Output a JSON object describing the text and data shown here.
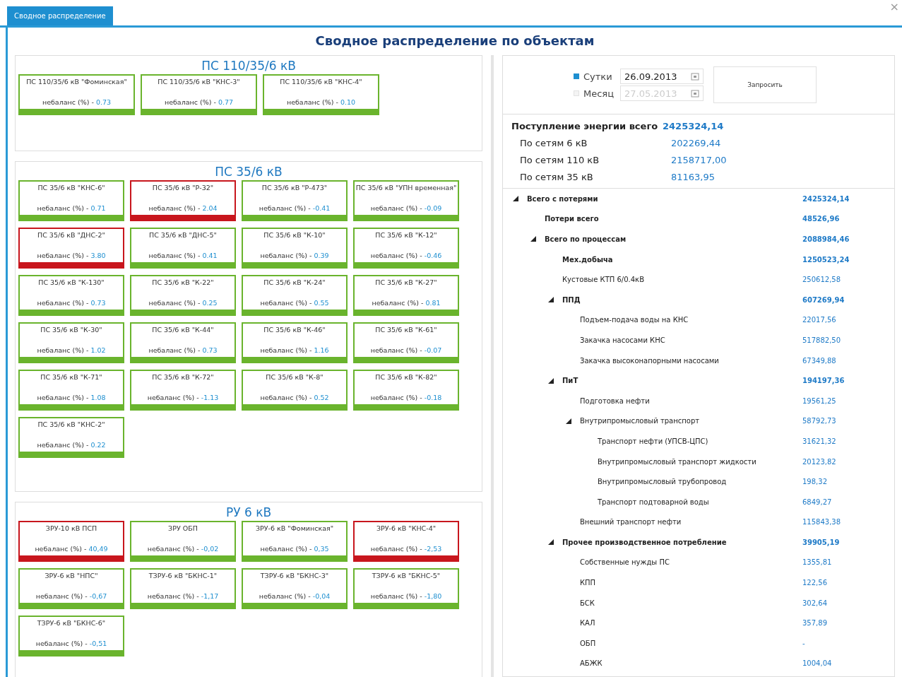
{
  "window": {
    "tab": "Сводное распределение",
    "close": "×"
  },
  "heading": "Сводное распределение по объектам",
  "groups": [
    {
      "title": "ПС 110/35/6 кВ",
      "wide": true,
      "cards": [
        {
          "name": "ПС 110/35/6 кВ \"Фоминская\"",
          "label": "небаланс (%) - ",
          "value": "0.73",
          "alarm": false
        },
        {
          "name": "ПС 110/35/6 кВ \"КНС-3\"",
          "label": "небаланс (%) - ",
          "value": "0.77",
          "alarm": false
        },
        {
          "name": "ПС 110/35/6 кВ \"КНС-4\"",
          "label": "небаланс (%) - ",
          "value": "0.10",
          "alarm": false
        }
      ]
    },
    {
      "title": "ПС 35/6 кВ",
      "wide": false,
      "cards": [
        {
          "name": "ПС 35/6 кВ \"КНС-6\"",
          "label": "небаланс (%) - ",
          "value": "0.71",
          "alarm": false
        },
        {
          "name": "ПС 35/6 кВ \"Р-32\"",
          "label": "небаланс (%) - ",
          "value": "2.04",
          "alarm": true
        },
        {
          "name": "ПС 35/6 кВ \"Р-473\"",
          "label": "небаланс (%) - ",
          "value": "-0.41",
          "alarm": false
        },
        {
          "name": "ПС 35/6 кВ \"УПН временная\"",
          "label": "небаланс (%) - ",
          "value": "-0.09",
          "alarm": false
        },
        {
          "name": "ПС 35/6 кВ \"ДНС-2\"",
          "label": "небаланс (%) - ",
          "value": "3.80",
          "alarm": true
        },
        {
          "name": "ПС 35/6 кВ \"ДНС-5\"",
          "label": "небаланс (%) - ",
          "value": "0.41",
          "alarm": false
        },
        {
          "name": "ПС 35/6 кВ \"К-10\"",
          "label": "небаланс (%) - ",
          "value": "0.39",
          "alarm": false
        },
        {
          "name": "ПС 35/6 кВ \"К-12\"",
          "label": "небаланс (%) - ",
          "value": "-0.46",
          "alarm": false
        },
        {
          "name": "ПС 35/6 кВ \"К-130\"",
          "label": "небаланс (%) - ",
          "value": "0.73",
          "alarm": false
        },
        {
          "name": "ПС 35/6 кВ \"К-22\"",
          "label": "небаланс (%) - ",
          "value": "0.25",
          "alarm": false
        },
        {
          "name": "ПС 35/6 кВ \"К-24\"",
          "label": "небаланс (%) - ",
          "value": "0.55",
          "alarm": false
        },
        {
          "name": "ПС 35/6 кВ \"К-27\"",
          "label": "небаланс (%) - ",
          "value": "0.81",
          "alarm": false
        },
        {
          "name": "ПС 35/6 кВ \"К-30\"",
          "label": "небаланс (%) - ",
          "value": "1.02",
          "alarm": false
        },
        {
          "name": "ПС 35/6 кВ \"К-44\"",
          "label": "небаланс (%) - ",
          "value": "0.73",
          "alarm": false
        },
        {
          "name": "ПС 35/6 кВ \"К-46\"",
          "label": "небаланс (%) - ",
          "value": "1.16",
          "alarm": false
        },
        {
          "name": "ПС 35/6 кВ \"К-61\"",
          "label": "небаланс (%) - ",
          "value": "-0.07",
          "alarm": false
        },
        {
          "name": "ПС 35/6 кВ \"К-71\"",
          "label": "небаланс (%) - ",
          "value": "1.08",
          "alarm": false
        },
        {
          "name": "ПС 35/6 кВ \"К-72\"",
          "label": "небаланс (%) - ",
          "value": "-1.13",
          "alarm": false
        },
        {
          "name": "ПС 35/6 кВ \"К-8\"",
          "label": "небаланс (%) - ",
          "value": "0.52",
          "alarm": false
        },
        {
          "name": "ПС 35/6 кВ \"К-82\"",
          "label": "небаланс (%) - ",
          "value": "-0.18",
          "alarm": false
        },
        {
          "name": "ПС 35/6 кВ \"КНС-2\"",
          "label": "небаланс (%) - ",
          "value": "0.22",
          "alarm": false
        }
      ]
    },
    {
      "title": "РУ 6 кВ",
      "wide": false,
      "cards": [
        {
          "name": "ЗРУ-10 кВ ПСП",
          "label": "небаланс (%) - ",
          "value": "40,49",
          "alarm": true
        },
        {
          "name": "ЗРУ ОБП",
          "label": "небаланс (%) - ",
          "value": "-0,02",
          "alarm": false
        },
        {
          "name": "ЗРУ-6 кВ \"Фоминская\"",
          "label": "небаланс (%) - ",
          "value": "0,35",
          "alarm": false
        },
        {
          "name": "ЗРУ-6 кВ \"КНС-4\"",
          "label": "небаланс (%) - ",
          "value": "-2,53",
          "alarm": true
        },
        {
          "name": "ЗРУ-6 кВ \"НПС\"",
          "label": "небаланс (%) - ",
          "value": "-0,67",
          "alarm": false
        },
        {
          "name": "ТЗРУ-6 кВ \"БКНС-1\"",
          "label": "небаланс (%) - ",
          "value": "-1,17",
          "alarm": false
        },
        {
          "name": "ТЗРУ-6 кВ \"БКНС-3\"",
          "label": "небаланс (%) - ",
          "value": "-0,04",
          "alarm": false
        },
        {
          "name": "ТЗРУ-6 кВ \"БКНС-5\"",
          "label": "небаланс (%) - ",
          "value": "-1,80",
          "alarm": false
        },
        {
          "name": "ТЗРУ-6 кВ \"БКНС-6\"",
          "label": "небаланс (%) - ",
          "value": "-0,51",
          "alarm": false
        }
      ]
    }
  ],
  "period": {
    "options": [
      {
        "label": "Сутки",
        "selected": true,
        "date": "26.09.2013",
        "disabled": false
      },
      {
        "label": "Месяц",
        "selected": false,
        "date": "27.05.2013",
        "disabled": true
      }
    ],
    "button": "Запросить"
  },
  "summary": [
    {
      "label": "Поступление энергии всего",
      "value": "2425324,14",
      "kind": "total"
    },
    {
      "label": "По сетям 6 кВ",
      "value": "202269,44",
      "kind": "item"
    },
    {
      "label": "По сетям 110 кВ",
      "value": "2158717,00",
      "kind": "item"
    },
    {
      "label": "По сетям 35 кВ",
      "value": "81163,95",
      "kind": "item"
    }
  ],
  "tree": [
    {
      "label": "Всего с потерями",
      "value": "2425324,14",
      "kind": "bold",
      "expanded": true,
      "children": [
        {
          "label": "Потери всего",
          "value": "48526,96",
          "kind": "bold"
        },
        {
          "label": "Всего по процессам",
          "value": "2088984,46",
          "kind": "bold",
          "expanded": true,
          "children": [
            {
              "label": "Мех.добыча",
              "value": "1250523,24",
              "kind": "bold"
            },
            {
              "label": "Кустовые КТП 6/0.4кВ",
              "value": "250612,58",
              "kind": "plain"
            },
            {
              "label": "ППД",
              "value": "607269,94",
              "kind": "bold",
              "expanded": true,
              "children": [
                {
                  "label": "Подъем-подача воды на КНС",
                  "value": "22017,56",
                  "kind": "plain"
                },
                {
                  "label": "Закачка насосами КНС",
                  "value": "517882,50",
                  "kind": "plain"
                },
                {
                  "label": "Закачка высоконапорными насосами",
                  "value": "67349,88",
                  "kind": "plain"
                }
              ]
            },
            {
              "label": "ПиТ",
              "value": "194197,36",
              "kind": "bold",
              "expanded": true,
              "children": [
                {
                  "label": "Подготовка нефти",
                  "value": "19561,25",
                  "kind": "plain"
                },
                {
                  "label": "Внутрипромысловый транспорт",
                  "value": "58792,73",
                  "kind": "plain",
                  "expanded": true,
                  "children": [
                    {
                      "label": "Транспорт нефти (УПСВ-ЦПС)",
                      "value": "31621,32",
                      "kind": "plain"
                    },
                    {
                      "label": "Внутрипромысловый транспорт жидкости",
                      "value": "20123,82",
                      "kind": "plain"
                    },
                    {
                      "label": "Внутрипромысловый трубопровод",
                      "value": "198,32",
                      "kind": "plain"
                    },
                    {
                      "label": "Транспорт подтоварной воды",
                      "value": "6849,27",
                      "kind": "plain"
                    }
                  ]
                },
                {
                  "label": "Внешний транспорт нефти",
                  "value": "115843,38",
                  "kind": "plain"
                }
              ]
            },
            {
              "label": "Прочее производственное потребление",
              "value": "39905,19",
              "kind": "bold",
              "expanded": true,
              "children": [
                {
                  "label": "Собственные нужды ПС",
                  "value": "1355,81",
                  "kind": "plain"
                },
                {
                  "label": "КПП",
                  "value": "122,56",
                  "kind": "plain"
                },
                {
                  "label": "БСК",
                  "value": "302,64",
                  "kind": "plain"
                },
                {
                  "label": "КАЛ",
                  "value": "357,89",
                  "kind": "plain"
                },
                {
                  "label": "ОБП",
                  "value": "-",
                  "kind": "plain"
                },
                {
                  "label": "АБЖК",
                  "value": "1004,04",
                  "kind": "plain"
                }
              ]
            }
          ]
        }
      ]
    }
  ]
}
